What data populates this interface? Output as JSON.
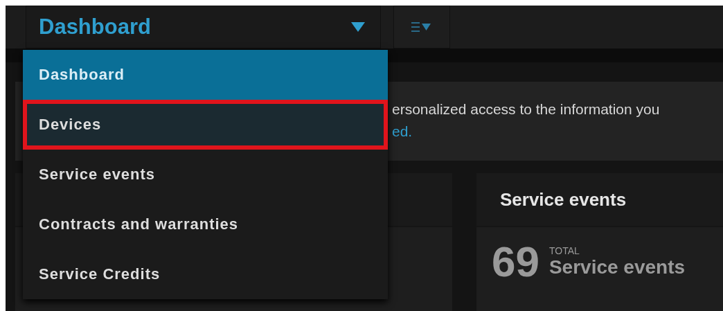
{
  "view_selector": {
    "label": "Dashboard",
    "expanded": true
  },
  "menu": [
    {
      "label": "Dashboard",
      "selected": true,
      "highlighted": false
    },
    {
      "label": "Devices",
      "selected": false,
      "highlighted": true
    },
    {
      "label": "Service events",
      "selected": false,
      "highlighted": false
    },
    {
      "label": "Contracts and warranties",
      "selected": false,
      "highlighted": false
    },
    {
      "label": "Service Credits",
      "selected": false,
      "highlighted": false
    }
  ],
  "banner": {
    "text": "ersonalized access to the information you",
    "link": "ed."
  },
  "service_card": {
    "title": "Service events",
    "count": "69",
    "count_caption": "TOTAL",
    "count_label": "Service events"
  }
}
